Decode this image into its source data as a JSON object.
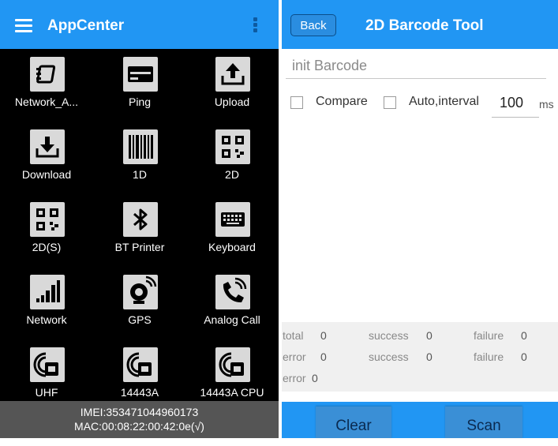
{
  "left": {
    "title": "AppCenter",
    "tiles": [
      {
        "label": "Network_A...",
        "icon": "network-adapter-icon"
      },
      {
        "label": "Ping",
        "icon": "ping-icon"
      },
      {
        "label": "Upload",
        "icon": "upload-icon"
      },
      {
        "label": "Download",
        "icon": "download-icon"
      },
      {
        "label": "1D",
        "icon": "barcode-1d-icon"
      },
      {
        "label": "2D",
        "icon": "qrcode-icon"
      },
      {
        "label": "2D(S)",
        "icon": "qrcode-icon"
      },
      {
        "label": "BT Printer",
        "icon": "bluetooth-icon"
      },
      {
        "label": "Keyboard",
        "icon": "keyboard-icon"
      },
      {
        "label": "Network",
        "icon": "signal-bars-icon"
      },
      {
        "label": "GPS",
        "icon": "satellite-dish-icon"
      },
      {
        "label": "Analog Call",
        "icon": "phone-ringing-icon"
      },
      {
        "label": "UHF",
        "icon": "rfid-card-icon"
      },
      {
        "label": "14443A",
        "icon": "rfid-card-icon"
      },
      {
        "label": "14443A CPU",
        "icon": "rfid-card-icon"
      }
    ],
    "footer": {
      "imei": "IMEI:353471044960173",
      "mac": "MAC:00:08:22:00:42:0e(√)"
    },
    "colors": {
      "accent": "#2196f3",
      "background": "#000000",
      "footer": "#555555"
    }
  },
  "right": {
    "back_label": "Back",
    "title": "2D Barcode Tool",
    "barcode_placeholder": "init Barcode",
    "compare_label": "Compare",
    "auto_label": "Auto,interval",
    "interval_value": "100",
    "interval_unit": "ms",
    "stats": {
      "row1": {
        "total_label": "total",
        "total_value": "0",
        "success_label": "success",
        "success_value": "0",
        "failure_label": "failure",
        "failure_value": "0"
      },
      "row2": {
        "error_label": "error",
        "error_value": "0",
        "success_label": "success",
        "success_value": "0",
        "failure_label": "failure",
        "failure_value": "0"
      },
      "row3": {
        "error_label": "error",
        "error_value": "0"
      }
    },
    "clear_label": "Clear",
    "scan_label": "Scan"
  }
}
